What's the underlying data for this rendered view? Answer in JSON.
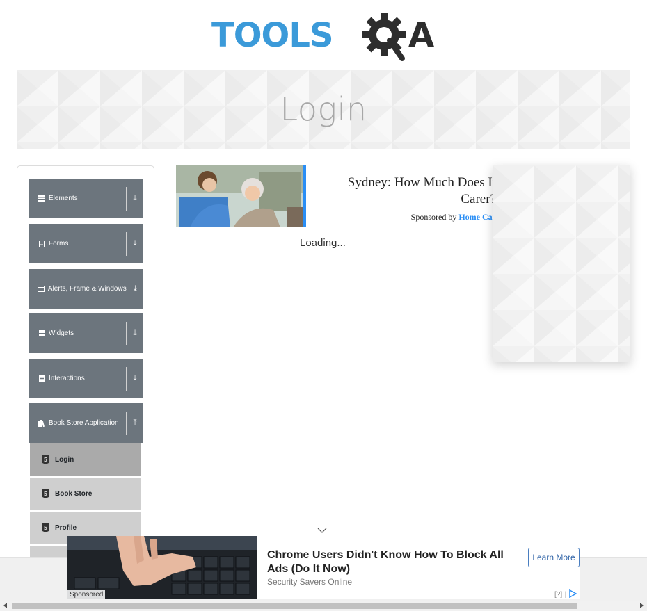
{
  "logo": {
    "text_left": "TOOLS",
    "text_right": "A",
    "brand_blue": "#3b9ad9",
    "brand_dark": "#2d2d2d"
  },
  "banner": {
    "title": "Login"
  },
  "sidebar": {
    "groups": [
      {
        "label": "Elements",
        "icon": "hamburger-icon",
        "arrow": "⤓"
      },
      {
        "label": "Forms",
        "icon": "document-icon",
        "arrow": "⤓"
      },
      {
        "label": "Alerts, Frame & Windows",
        "icon": "window-icon",
        "arrow": "⤓"
      },
      {
        "label": "Widgets",
        "icon": "grid-icon",
        "arrow": "⤓"
      },
      {
        "label": "Interactions",
        "icon": "interaction-icon",
        "arrow": "⤓"
      },
      {
        "label": "Book Store Application",
        "icon": "books-icon",
        "arrow": "⤒"
      }
    ],
    "items": [
      {
        "label": "Login",
        "active": true
      },
      {
        "label": "Book Store",
        "active": false
      },
      {
        "label": "Profile",
        "active": false
      }
    ]
  },
  "sponsored": {
    "headline": "Sydney: How Much Does It Carer?",
    "sponsored_by": "Sponsored by",
    "brand": "Home Car",
    "accent": "#2a8ef5"
  },
  "loading_text": "Loading...",
  "bottom_ad": {
    "headline": "Chrome Users Didn't Know How To Block All Ads (Do It Now)",
    "source": "Security Savers Online",
    "cta": "Learn More",
    "sponsored_tag": "Sponsored",
    "adchoices": "[?]"
  }
}
